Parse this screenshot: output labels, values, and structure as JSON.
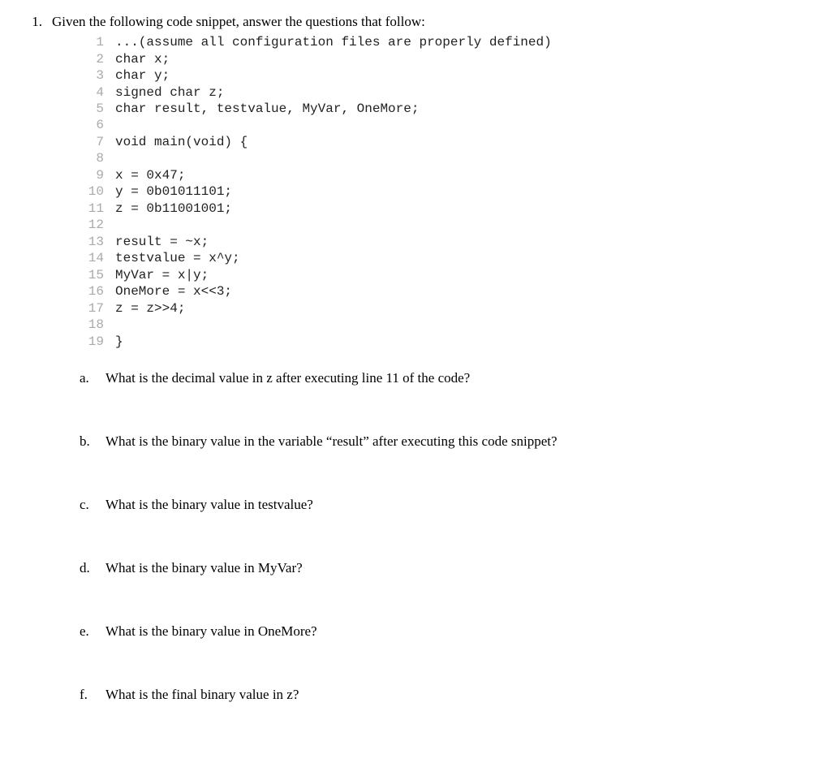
{
  "question": {
    "number": "1.",
    "prompt": "Given the following code snippet, answer the questions that follow:"
  },
  "code": {
    "lines": [
      {
        "n": "1",
        "t": "...(assume all configuration files are properly defined)"
      },
      {
        "n": "2",
        "t": "char x;"
      },
      {
        "n": "3",
        "t": "char y;"
      },
      {
        "n": "4",
        "t": "signed char z;"
      },
      {
        "n": "5",
        "t": "char result, testvalue, MyVar, OneMore;"
      },
      {
        "n": "6",
        "t": ""
      },
      {
        "n": "7",
        "t": "void main(void) {"
      },
      {
        "n": "8",
        "t": ""
      },
      {
        "n": "9",
        "t": "x = 0x47;"
      },
      {
        "n": "10",
        "t": "y = 0b01011101;"
      },
      {
        "n": "11",
        "t": "z = 0b11001001;"
      },
      {
        "n": "12",
        "t": ""
      },
      {
        "n": "13",
        "t": "result = ~x;"
      },
      {
        "n": "14",
        "t": "testvalue = x^y;"
      },
      {
        "n": "15",
        "t": "MyVar = x|y;"
      },
      {
        "n": "16",
        "t": "OneMore = x<<3;"
      },
      {
        "n": "17",
        "t": "z = z>>4;"
      },
      {
        "n": "18",
        "t": ""
      },
      {
        "n": "19",
        "t": "}"
      }
    ]
  },
  "subquestions": [
    {
      "letter": "a.",
      "text": "What is the decimal value in z after executing line 11 of the code?"
    },
    {
      "letter": "b.",
      "text": "What is the binary value in the variable “result” after executing this code snippet?"
    },
    {
      "letter": "c.",
      "text": "What is the binary value in testvalue?"
    },
    {
      "letter": "d.",
      "text": "What is the binary value in MyVar?"
    },
    {
      "letter": "e.",
      "text": "What is the binary value in OneMore?"
    },
    {
      "letter": "f.",
      "text": "What is the final binary value in z?"
    }
  ]
}
